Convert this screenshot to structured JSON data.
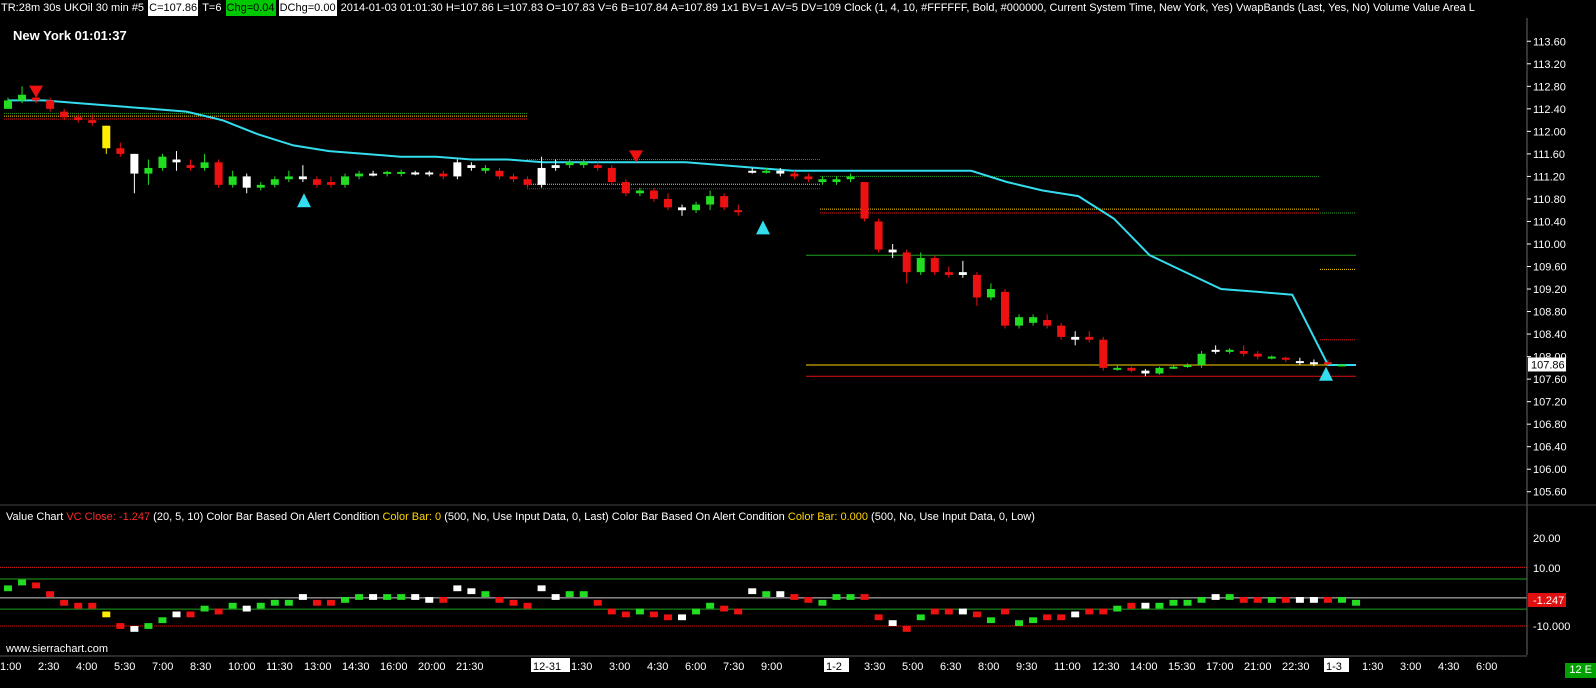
{
  "header": {
    "study": "TR:28m 30s UKOil  30 min   #5",
    "close": "C=107.86",
    "trades": "T=6",
    "chg": "Chg=0.04",
    "dchg": "DChg=0.00",
    "rest": "2014-01-03 01:01:30 H=107.86 L=107.83 O=107.83 V=6 B=107.84 A=107.89 1x1 BV=1 AV=5 DV=109  Clock   (1, 4, 10, #FFFFFF, Bold, #000000, Current System Time, New York, Yes)  VwapBands   (Last, Yes, No)  Volume Value Area L"
  },
  "clock_text": "New York 01:01:37",
  "value_chart_header": {
    "name": "Value Chart",
    "vc_close": "VC Close: -1.247",
    "params1": "(20, 5, 10)  Color Bar Based On Alert Condition",
    "color_bar_1": "Color Bar: 0",
    "params2": "(500, No, Use Input Data, 0, Last)  Color Bar Based On Alert Condition",
    "color_bar_2": "Color Bar: 0.000",
    "params3": "(500, No, Use Input Data, 0, Low)"
  },
  "watermark": "www.sierrachart.com",
  "corner_tag": "12 E",
  "colors": {
    "up": "#22dd22",
    "down": "#ee1111",
    "neutral": "#ffffff",
    "highlight": "#ffee00",
    "vwap": "#33ddee",
    "accent": "#00a000"
  },
  "price_axis_labels": [
    "113.60",
    "113.20",
    "112.80",
    "112.40",
    "112.00",
    "111.60",
    "111.20",
    "110.80",
    "110.40",
    "110.00",
    "109.60",
    "109.20",
    "108.80",
    "108.40",
    "108.00",
    "107.60",
    "107.20",
    "106.80",
    "106.40",
    "106.00",
    "105.60"
  ],
  "last_price_label": "107.86",
  "vc_axis_labels": [
    "20.00",
    "10.00",
    "-10.000"
  ],
  "vc_last_label": "-1.247",
  "time_labels": [
    "1:00",
    "2:30",
    "4:00",
    "5:30",
    "7:00",
    "8:30",
    "10:00",
    "11:30",
    "13:00",
    "14:30",
    "16:00",
    "20:00",
    "21:30",
    "12-31",
    "1:30",
    "3:00",
    "4:30",
    "6:00",
    "7:30",
    "9:00",
    "1-2",
    "3:30",
    "5:00",
    "6:30",
    "8:00",
    "9:30",
    "11:00",
    "12:30",
    "14:00",
    "15:30",
    "17:00",
    "21:00",
    "22:30",
    "1-3",
    "1:30",
    "3:00",
    "4:30",
    "6:00"
  ],
  "chart_data": {
    "type": "candlestick",
    "ylim": [
      105.4,
      113.8
    ],
    "vwap": [
      112.55,
      112.55,
      112.5,
      112.45,
      112.4,
      112.35,
      112.2,
      111.95,
      111.75,
      111.65,
      111.6,
      111.55,
      111.55,
      111.5,
      111.5,
      111.45,
      111.45,
      111.45,
      111.45,
      111.45,
      111.4,
      111.35,
      111.3,
      111.3,
      111.3,
      111.3,
      111.3,
      111.3,
      111.1,
      110.95,
      110.85,
      110.45,
      109.8,
      109.5,
      109.2,
      109.15,
      109.1,
      107.85
    ],
    "candles": [
      {
        "o": 112.4,
        "c": 112.55,
        "h": 112.6,
        "l": 112.4,
        "col": "up"
      },
      {
        "o": 112.55,
        "c": 112.65,
        "h": 112.8,
        "l": 112.5,
        "col": "up"
      },
      {
        "o": 112.6,
        "c": 112.55,
        "h": 112.7,
        "l": 112.5,
        "col": "down"
      },
      {
        "o": 112.55,
        "c": 112.4,
        "h": 112.6,
        "l": 112.35,
        "col": "down"
      },
      {
        "o": 112.35,
        "c": 112.25,
        "h": 112.4,
        "l": 112.2,
        "col": "down"
      },
      {
        "o": 112.25,
        "c": 112.2,
        "h": 112.3,
        "l": 112.15,
        "col": "down"
      },
      {
        "o": 112.2,
        "c": 112.15,
        "h": 112.3,
        "l": 112.1,
        "col": "down"
      },
      {
        "o": 112.1,
        "c": 111.7,
        "h": 112.1,
        "l": 111.6,
        "col": "highlight"
      },
      {
        "o": 111.7,
        "c": 111.6,
        "h": 111.8,
        "l": 111.55,
        "col": "down"
      },
      {
        "o": 111.6,
        "c": 111.25,
        "h": 111.6,
        "l": 110.9,
        "col": "neutral"
      },
      {
        "o": 111.25,
        "c": 111.35,
        "h": 111.5,
        "l": 111.05,
        "col": "up"
      },
      {
        "o": 111.35,
        "c": 111.55,
        "h": 111.6,
        "l": 111.3,
        "col": "up"
      },
      {
        "o": 111.5,
        "c": 111.45,
        "h": 111.65,
        "l": 111.3,
        "col": "neutral"
      },
      {
        "o": 111.4,
        "c": 111.35,
        "h": 111.5,
        "l": 111.3,
        "col": "down"
      },
      {
        "o": 111.35,
        "c": 111.45,
        "h": 111.6,
        "l": 111.3,
        "col": "up"
      },
      {
        "o": 111.45,
        "c": 111.05,
        "h": 111.5,
        "l": 111.0,
        "col": "down"
      },
      {
        "o": 111.05,
        "c": 111.2,
        "h": 111.3,
        "l": 111.0,
        "col": "up"
      },
      {
        "o": 111.2,
        "c": 111.0,
        "h": 111.25,
        "l": 110.9,
        "col": "neutral"
      },
      {
        "o": 111.0,
        "c": 111.05,
        "h": 111.1,
        "l": 110.95,
        "col": "up"
      },
      {
        "o": 111.05,
        "c": 111.15,
        "h": 111.2,
        "l": 111.0,
        "col": "up"
      },
      {
        "o": 111.15,
        "c": 111.2,
        "h": 111.3,
        "l": 111.1,
        "col": "up"
      },
      {
        "o": 111.2,
        "c": 111.15,
        "h": 111.4,
        "l": 111.1,
        "col": "neutral"
      },
      {
        "o": 111.15,
        "c": 111.05,
        "h": 111.2,
        "l": 111.0,
        "col": "down"
      },
      {
        "o": 111.05,
        "c": 111.1,
        "h": 111.2,
        "l": 111.0,
        "col": "down"
      },
      {
        "o": 111.05,
        "c": 111.2,
        "h": 111.25,
        "l": 111.0,
        "col": "up"
      },
      {
        "o": 111.2,
        "c": 111.25,
        "h": 111.3,
        "l": 111.15,
        "col": "up"
      },
      {
        "o": 111.25,
        "c": 111.25,
        "h": 111.3,
        "l": 111.2,
        "col": "neutral"
      },
      {
        "o": 111.25,
        "c": 111.28,
        "h": 111.3,
        "l": 111.2,
        "col": "up"
      },
      {
        "o": 111.28,
        "c": 111.25,
        "h": 111.32,
        "l": 111.2,
        "col": "up"
      },
      {
        "o": 111.25,
        "c": 111.27,
        "h": 111.3,
        "l": 111.22,
        "col": "neutral"
      },
      {
        "o": 111.27,
        "c": 111.25,
        "h": 111.3,
        "l": 111.2,
        "col": "neutral"
      },
      {
        "o": 111.25,
        "c": 111.2,
        "h": 111.3,
        "l": 111.15,
        "col": "down"
      },
      {
        "o": 111.2,
        "c": 111.45,
        "h": 111.5,
        "l": 111.15,
        "col": "neutral"
      },
      {
        "o": 111.4,
        "c": 111.35,
        "h": 111.45,
        "l": 111.3,
        "col": "neutral"
      },
      {
        "o": 111.35,
        "c": 111.3,
        "h": 111.4,
        "l": 111.25,
        "col": "up"
      },
      {
        "o": 111.3,
        "c": 111.2,
        "h": 111.35,
        "l": 111.15,
        "col": "down"
      },
      {
        "o": 111.2,
        "c": 111.15,
        "h": 111.25,
        "l": 111.1,
        "col": "down"
      },
      {
        "o": 111.15,
        "c": 111.05,
        "h": 111.2,
        "l": 111.0,
        "col": "down"
      },
      {
        "o": 111.05,
        "c": 111.35,
        "h": 111.55,
        "l": 111.0,
        "col": "neutral"
      },
      {
        "o": 111.35,
        "c": 111.4,
        "h": 111.5,
        "l": 111.3,
        "col": "neutral"
      },
      {
        "o": 111.4,
        "c": 111.45,
        "h": 111.5,
        "l": 111.35,
        "col": "up"
      },
      {
        "o": 111.45,
        "c": 111.4,
        "h": 111.5,
        "l": 111.35,
        "col": "up"
      },
      {
        "o": 111.4,
        "c": 111.35,
        "h": 111.45,
        "l": 111.3,
        "col": "down"
      },
      {
        "o": 111.35,
        "c": 111.1,
        "h": 111.4,
        "l": 111.05,
        "col": "down"
      },
      {
        "o": 111.1,
        "c": 110.9,
        "h": 111.15,
        "l": 110.85,
        "col": "down"
      },
      {
        "o": 110.9,
        "c": 110.95,
        "h": 111.0,
        "l": 110.85,
        "col": "up"
      },
      {
        "o": 110.95,
        "c": 110.8,
        "h": 111.0,
        "l": 110.75,
        "col": "down"
      },
      {
        "o": 110.8,
        "c": 110.65,
        "h": 110.9,
        "l": 110.6,
        "col": "down"
      },
      {
        "o": 110.65,
        "c": 110.6,
        "h": 110.7,
        "l": 110.5,
        "col": "neutral"
      },
      {
        "o": 110.6,
        "c": 110.7,
        "h": 110.75,
        "l": 110.55,
        "col": "up"
      },
      {
        "o": 110.7,
        "c": 110.85,
        "h": 110.95,
        "l": 110.6,
        "col": "up"
      },
      {
        "o": 110.85,
        "c": 110.65,
        "h": 110.9,
        "l": 110.6,
        "col": "down"
      },
      {
        "o": 110.6,
        "c": 110.6,
        "h": 110.7,
        "l": 110.5,
        "col": "down"
      },
      {
        "o": 111.3,
        "c": 111.28,
        "h": 111.35,
        "l": 111.25,
        "col": "neutral"
      },
      {
        "o": 111.28,
        "c": 111.3,
        "h": 111.35,
        "l": 111.25,
        "col": "up"
      },
      {
        "o": 111.3,
        "c": 111.25,
        "h": 111.35,
        "l": 111.2,
        "col": "neutral"
      },
      {
        "o": 111.25,
        "c": 111.2,
        "h": 111.3,
        "l": 111.15,
        "col": "down"
      },
      {
        "o": 111.2,
        "c": 111.15,
        "h": 111.25,
        "l": 111.1,
        "col": "down"
      },
      {
        "o": 111.15,
        "c": 111.1,
        "h": 111.2,
        "l": 111.05,
        "col": "up"
      },
      {
        "o": 111.1,
        "c": 111.15,
        "h": 111.2,
        "l": 111.05,
        "col": "up"
      },
      {
        "o": 111.15,
        "c": 111.2,
        "h": 111.25,
        "l": 111.1,
        "col": "up"
      },
      {
        "o": 111.1,
        "c": 110.45,
        "h": 111.1,
        "l": 110.4,
        "col": "down"
      },
      {
        "o": 110.4,
        "c": 109.9,
        "h": 110.45,
        "l": 109.85,
        "col": "down"
      },
      {
        "o": 109.9,
        "c": 109.85,
        "h": 110.0,
        "l": 109.75,
        "col": "neutral"
      },
      {
        "o": 109.85,
        "c": 109.5,
        "h": 109.9,
        "l": 109.3,
        "col": "down"
      },
      {
        "o": 109.5,
        "c": 109.75,
        "h": 109.85,
        "l": 109.45,
        "col": "up"
      },
      {
        "o": 109.75,
        "c": 109.5,
        "h": 109.8,
        "l": 109.45,
        "col": "down"
      },
      {
        "o": 109.5,
        "c": 109.45,
        "h": 109.6,
        "l": 109.4,
        "col": "down"
      },
      {
        "o": 109.45,
        "c": 109.5,
        "h": 109.7,
        "l": 109.4,
        "col": "neutral"
      },
      {
        "o": 109.45,
        "c": 109.05,
        "h": 109.5,
        "l": 108.9,
        "col": "down"
      },
      {
        "o": 109.05,
        "c": 109.2,
        "h": 109.3,
        "l": 109.0,
        "col": "up"
      },
      {
        "o": 109.15,
        "c": 108.55,
        "h": 109.2,
        "l": 108.5,
        "col": "down"
      },
      {
        "o": 108.55,
        "c": 108.7,
        "h": 108.75,
        "l": 108.5,
        "col": "up"
      },
      {
        "o": 108.7,
        "c": 108.6,
        "h": 108.75,
        "l": 108.55,
        "col": "up"
      },
      {
        "o": 108.65,
        "c": 108.55,
        "h": 108.75,
        "l": 108.5,
        "col": "down"
      },
      {
        "o": 108.55,
        "c": 108.35,
        "h": 108.6,
        "l": 108.3,
        "col": "down"
      },
      {
        "o": 108.35,
        "c": 108.3,
        "h": 108.45,
        "l": 108.2,
        "col": "neutral"
      },
      {
        "o": 108.35,
        "c": 108.3,
        "h": 108.45,
        "l": 108.25,
        "col": "down"
      },
      {
        "o": 108.3,
        "c": 107.8,
        "h": 108.35,
        "l": 107.75,
        "col": "down"
      },
      {
        "o": 107.8,
        "c": 107.8,
        "h": 107.85,
        "l": 107.75,
        "col": "up"
      },
      {
        "o": 107.8,
        "c": 107.75,
        "h": 107.82,
        "l": 107.72,
        "col": "down"
      },
      {
        "o": 107.75,
        "c": 107.7,
        "h": 107.78,
        "l": 107.65,
        "col": "neutral"
      },
      {
        "o": 107.7,
        "c": 107.8,
        "h": 107.82,
        "l": 107.68,
        "col": "up"
      },
      {
        "o": 107.8,
        "c": 107.82,
        "h": 107.85,
        "l": 107.78,
        "col": "up"
      },
      {
        "o": 107.82,
        "c": 107.85,
        "h": 107.88,
        "l": 107.8,
        "col": "up"
      },
      {
        "o": 107.85,
        "c": 108.05,
        "h": 108.1,
        "l": 107.8,
        "col": "up"
      },
      {
        "o": 108.1,
        "c": 108.12,
        "h": 108.2,
        "l": 108.05,
        "col": "neutral"
      },
      {
        "o": 108.12,
        "c": 108.1,
        "h": 108.15,
        "l": 108.05,
        "col": "up"
      },
      {
        "o": 108.1,
        "c": 108.05,
        "h": 108.2,
        "l": 108.0,
        "col": "down"
      },
      {
        "o": 108.05,
        "c": 108.0,
        "h": 108.1,
        "l": 107.95,
        "col": "down"
      },
      {
        "o": 108.0,
        "c": 107.98,
        "h": 108.02,
        "l": 107.95,
        "col": "up"
      },
      {
        "o": 107.98,
        "c": 107.95,
        "h": 108.0,
        "l": 107.9,
        "col": "down"
      },
      {
        "o": 107.9,
        "c": 107.92,
        "h": 107.98,
        "l": 107.85,
        "col": "neutral"
      },
      {
        "o": 107.9,
        "c": 107.88,
        "h": 107.95,
        "l": 107.83,
        "col": "neutral"
      },
      {
        "o": 107.88,
        "c": 107.9,
        "h": 107.95,
        "l": 107.85,
        "col": "down"
      },
      {
        "o": 107.83,
        "c": 107.86,
        "h": 107.86,
        "l": 107.83,
        "col": "up"
      }
    ],
    "value_chart": [
      4,
      6,
      5,
      2,
      -1,
      -2,
      -2,
      -5,
      -9,
      -10,
      -9,
      -7,
      -5,
      -5,
      -3,
      -4,
      -2,
      -3,
      -2,
      -1,
      -1,
      1,
      -1,
      -1,
      0,
      1,
      1,
      1,
      1,
      1,
      0,
      0,
      4,
      3,
      2,
      0,
      -1,
      -2,
      4,
      1,
      2,
      2,
      -1,
      -4,
      -5,
      -4,
      -5,
      -6,
      -6,
      -4,
      -2,
      -3,
      -4,
      3,
      2,
      2,
      1,
      0,
      -1,
      1,
      1,
      1,
      -6,
      -8,
      -10,
      -6,
      -4,
      -4,
      -4,
      -5,
      -7,
      -4,
      -8,
      -7,
      -6,
      -6,
      -5,
      -4,
      -4,
      -3,
      -2,
      -2,
      -2,
      -1,
      -1,
      0,
      1,
      1,
      0,
      0,
      0,
      0,
      0,
      0,
      0,
      0,
      -1
    ]
  }
}
